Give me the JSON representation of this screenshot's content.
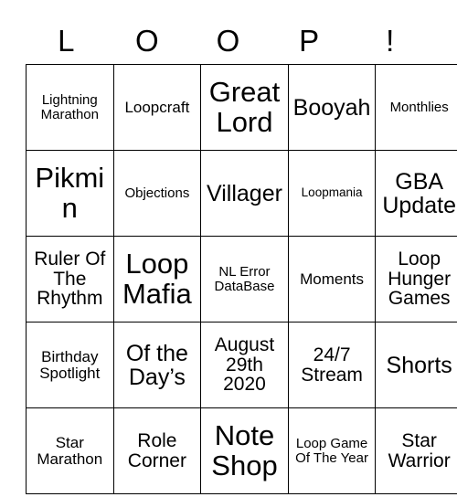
{
  "card": {
    "title_letters": [
      "L",
      "O",
      "O",
      "P",
      "!"
    ],
    "rows": [
      [
        {
          "text": "Lightning Marathon",
          "size": "fs-xs"
        },
        {
          "text": "Loopcraft",
          "size": "fs-sm"
        },
        {
          "text": "Great Lord",
          "size": "fs-xl"
        },
        {
          "text": "Booyah",
          "size": "fs-lg"
        },
        {
          "text": "Monthlies",
          "size": "fs-xs"
        }
      ],
      [
        {
          "text": "Pikmin",
          "size": "fs-xl"
        },
        {
          "text": "Objections",
          "size": "fs-xs"
        },
        {
          "text": "Villager",
          "size": "fs-lg"
        },
        {
          "text": "Loopmania",
          "size": "fs-xxs"
        },
        {
          "text": "GBA Update",
          "size": "fs-lg"
        }
      ],
      [
        {
          "text": "Ruler Of The Rhythm",
          "size": "fs-md"
        },
        {
          "text": "Loop Mafia",
          "size": "fs-xl"
        },
        {
          "text": "NL Error DataBase",
          "size": "fs-xs"
        },
        {
          "text": "Moments",
          "size": "fs-sm"
        },
        {
          "text": "Loop Hunger Games",
          "size": "fs-md"
        }
      ],
      [
        {
          "text": "Birthday Spotlight",
          "size": "fs-sm"
        },
        {
          "text": "Of the Day’s",
          "size": "fs-lg"
        },
        {
          "text": "August 29th 2020",
          "size": "fs-md"
        },
        {
          "text": "24/7 Stream",
          "size": "fs-md"
        },
        {
          "text": "Shorts",
          "size": "fs-lg"
        }
      ],
      [
        {
          "text": "Star Marathon",
          "size": "fs-sm"
        },
        {
          "text": "Role Corner",
          "size": "fs-md"
        },
        {
          "text": "Note Shop",
          "size": "fs-xl"
        },
        {
          "text": "Loop Game Of The Year",
          "size": "fs-xs"
        },
        {
          "text": "Star Warrior",
          "size": "fs-md"
        }
      ]
    ]
  }
}
